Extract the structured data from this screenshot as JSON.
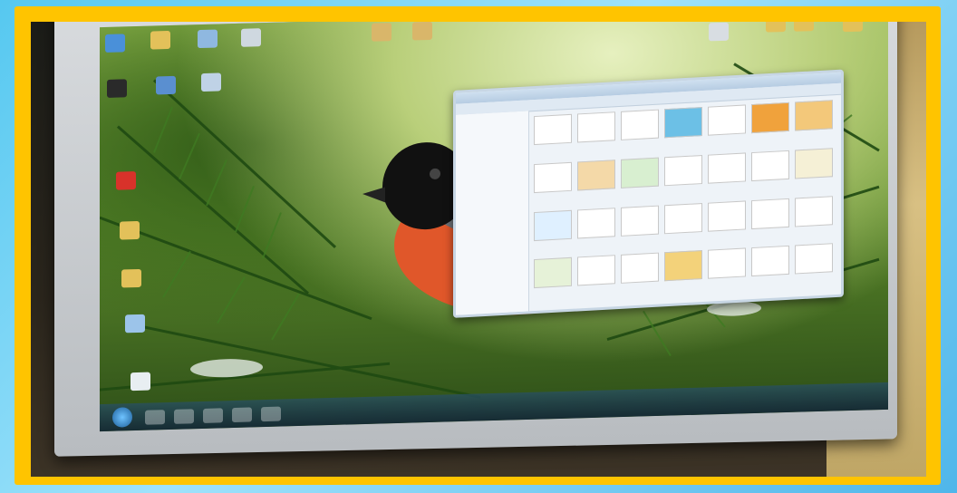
{
  "colors": {
    "frame": "#ffc400",
    "background": "#56c8f0",
    "screen_sky": "#b9cf7a",
    "bird_breast": "#e0572a"
  },
  "scene": {
    "subject": "bullfinch-wallpaper",
    "window": "file-explorer-thumbnails"
  },
  "icons": [
    "computer-icon",
    "folder-icon",
    "recycle-bin-icon",
    "shutdown-icon",
    "document-icon",
    "music-icon",
    "yandex-icon"
  ]
}
